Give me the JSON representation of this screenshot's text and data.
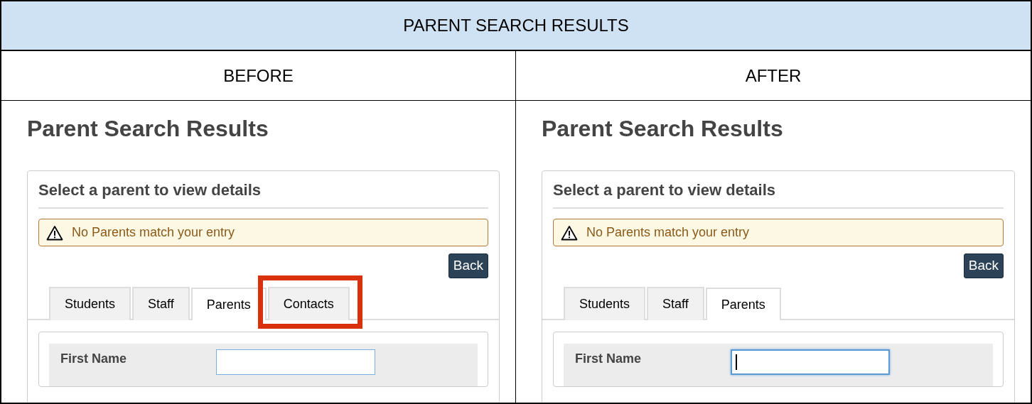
{
  "title": "PARENT SEARCH RESULTS",
  "columns": [
    {
      "heading": "BEFORE",
      "screen": {
        "page_title": "Parent Search Results",
        "card_title": "Select a parent to view details",
        "alert": "No Parents match your entry",
        "back_button": "Back",
        "tabs": [
          {
            "label": "Students",
            "selected": false,
            "highlighted": false
          },
          {
            "label": "Staff",
            "selected": false,
            "highlighted": false
          },
          {
            "label": "Parents",
            "selected": true,
            "highlighted": false
          },
          {
            "label": "Contacts",
            "selected": false,
            "highlighted": true
          }
        ],
        "field": {
          "label": "First Name",
          "focused": false
        }
      }
    },
    {
      "heading": "AFTER",
      "screen": {
        "page_title": "Parent Search Results",
        "card_title": "Select a parent to view details",
        "alert": "No Parents match your entry",
        "back_button": "Back",
        "tabs": [
          {
            "label": "Students",
            "selected": false,
            "highlighted": false
          },
          {
            "label": "Staff",
            "selected": false,
            "highlighted": false
          },
          {
            "label": "Parents",
            "selected": true,
            "highlighted": false
          }
        ],
        "field": {
          "label": "First Name",
          "focused": true
        }
      }
    }
  ]
}
